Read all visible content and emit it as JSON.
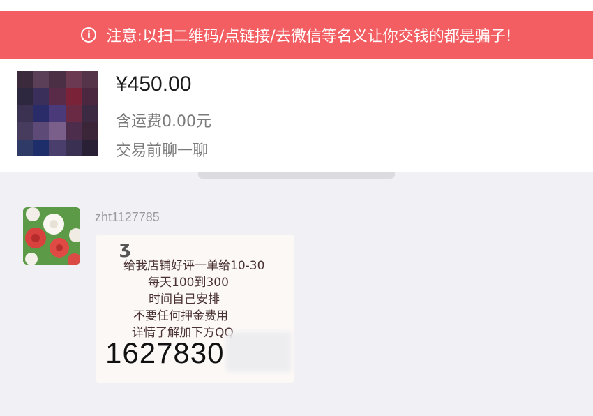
{
  "warning": {
    "icon": "info-icon",
    "text": "注意:以扫二维码/点链接/去微信等名义让你交钱的都是骗子!",
    "color": "#f25e62"
  },
  "product": {
    "price": "¥450.00",
    "shipping": "含运费0.00元",
    "chat_hint": "交易前聊一聊"
  },
  "message": {
    "username": "zht1127785",
    "ad_image": {
      "lines": [
        "给我店铺好评一单给10-30",
        "每天100到300",
        "时间自己安排",
        "不要任何押金费用",
        "详情了解加下方QQ"
      ],
      "number": "1627830"
    }
  }
}
